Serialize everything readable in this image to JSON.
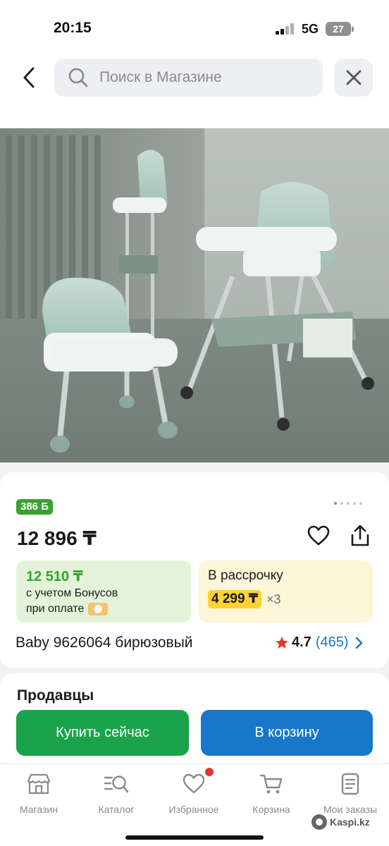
{
  "status_bar": {
    "time": "20:15",
    "network": "5G",
    "battery": "27"
  },
  "header": {
    "search_placeholder": "Поиск в Магазине",
    "icons": [
      "chevron-left-icon",
      "search-icon",
      "close-icon"
    ]
  },
  "gallery": {
    "total_slides": 5,
    "active_slide": 1
  },
  "product": {
    "bonus_badge": "386 Б",
    "price": "12 896 ₸",
    "bonus_price": "12 510 ₸",
    "bonus_note_line1": "с учетом Бонусов",
    "bonus_note_line2": "при оплате",
    "installment_title": "В рассрочку",
    "installment_amount": "4 299 ₸",
    "installment_months": "×3",
    "name": "Baby 9626064 бирюзовый",
    "rating": "4.7",
    "reviews": "(465)",
    "colors": {
      "bonus_green": "#3aa130",
      "link_blue": "#1877c9",
      "installment_yellow": "#ffd234",
      "star_red": "#e3342f"
    }
  },
  "sellers": {
    "title": "Продавцы"
  },
  "actions": {
    "buy_now": "Купить сейчас",
    "add_to_cart": "В корзину",
    "buy_color": "#1aa34a",
    "cart_color": "#1877c9"
  },
  "bottom_nav": {
    "items": [
      {
        "label": "Магазин",
        "icon": "store-icon"
      },
      {
        "label": "Каталог",
        "icon": "catalog-search-icon"
      },
      {
        "label": "Избранное",
        "icon": "heart-icon"
      },
      {
        "label": "Корзина",
        "icon": "cart-icon"
      },
      {
        "label": "Мои заказы",
        "icon": "orders-icon"
      }
    ]
  },
  "watermark": "Kaspi.kz"
}
